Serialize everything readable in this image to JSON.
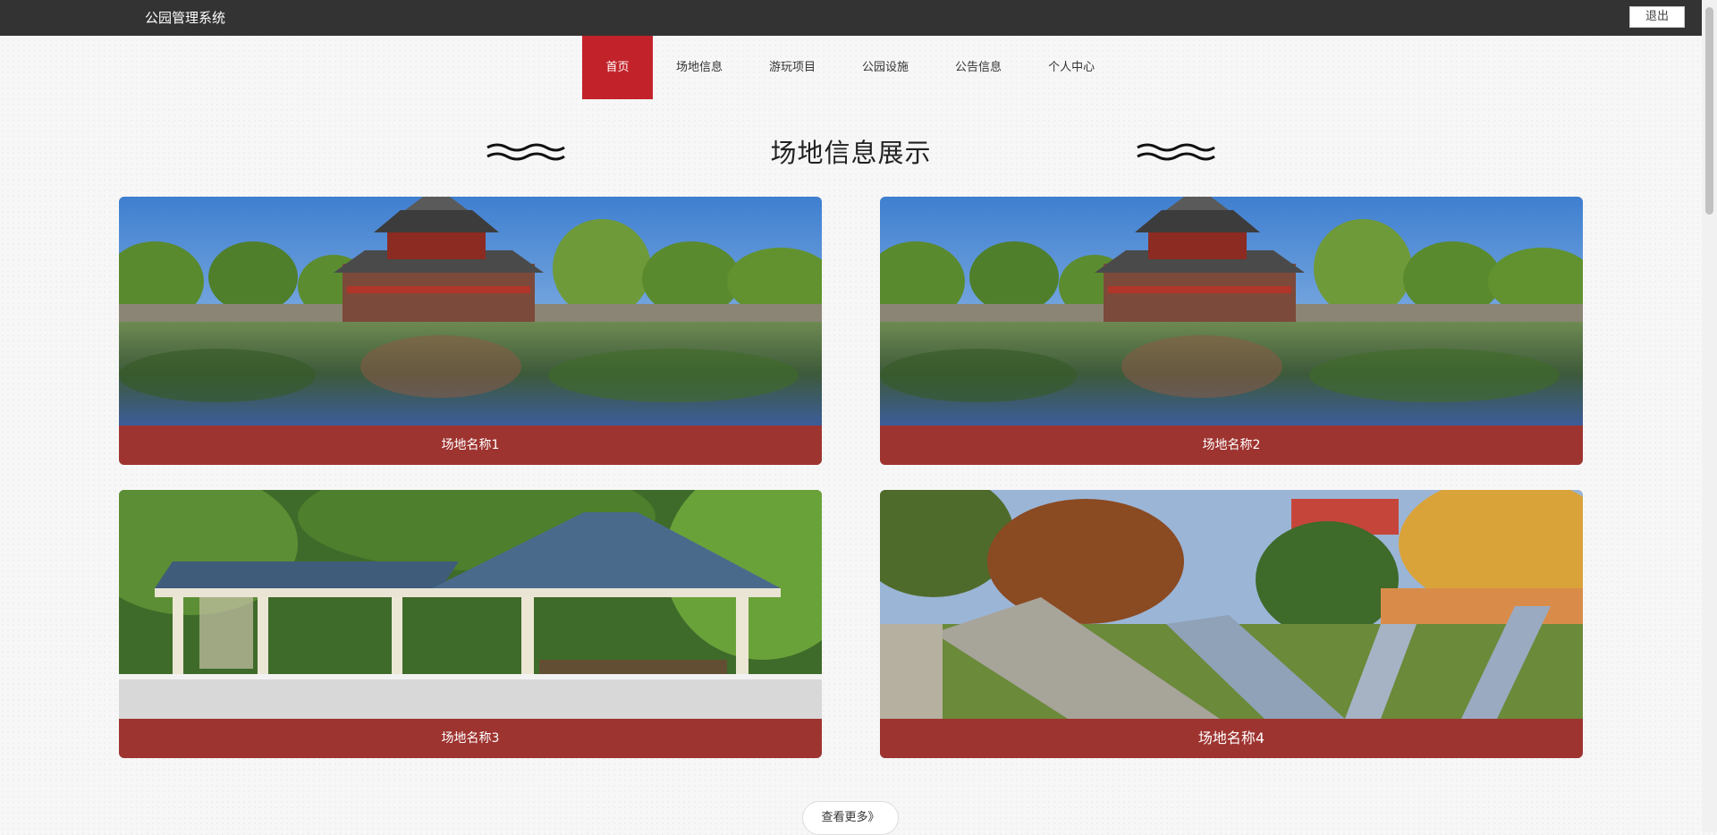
{
  "header": {
    "title": "公园管理系统",
    "logout_label": "退出"
  },
  "nav": {
    "items": [
      {
        "label": "首页",
        "active": true
      },
      {
        "label": "场地信息"
      },
      {
        "label": "游玩项目"
      },
      {
        "label": "公园设施"
      },
      {
        "label": "公告信息"
      },
      {
        "label": "个人中心"
      }
    ]
  },
  "section": {
    "title": "场地信息展示"
  },
  "venues": [
    {
      "name": "场地名称1",
      "image": "palace-corner-tower-moat"
    },
    {
      "name": "场地名称2",
      "image": "palace-corner-tower-moat"
    },
    {
      "name": "场地名称3",
      "image": "lakeside-pavilion-corridor"
    },
    {
      "name": "场地名称4",
      "image": "playground-slides-autumn"
    }
  ],
  "more_label": "查看更多》",
  "colors": {
    "topbar": "#333333",
    "nav_active": "#c2232a",
    "caption_bg": "#9e3430"
  }
}
